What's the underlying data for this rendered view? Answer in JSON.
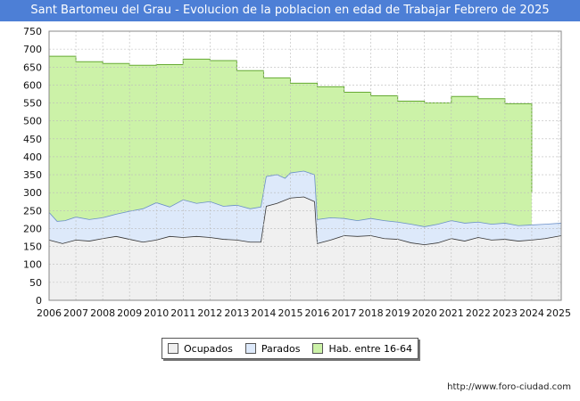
{
  "chart_data": {
    "type": "area",
    "title": "Sant Bartomeu del Grau - Evolucion de la poblacion en edad de Trabajar Febrero de 2025",
    "xlabel": "",
    "ylabel": "",
    "ylim": [
      0,
      750
    ],
    "xlim": [
      2006,
      2025.1
    ],
    "yticks": [
      0,
      50,
      100,
      150,
      200,
      250,
      300,
      350,
      400,
      450,
      500,
      550,
      600,
      650,
      700,
      750
    ],
    "xticks": [
      "2006",
      "2007",
      "2008",
      "2009",
      "2010",
      "2011",
      "2012",
      "2013",
      "2014",
      "2015",
      "2016",
      "2017",
      "2018",
      "2019",
      "2020",
      "2021",
      "2022",
      "2023",
      "2024",
      "2025"
    ],
    "grid": true,
    "legend_position": "bottom",
    "colors": {
      "hab": "#ccf2a8",
      "hab_line": "#66aa33",
      "parados": "#dde9fa",
      "parados_line": "#333333",
      "ocupados": "#f0f0f0",
      "ocupados_line": "#333333"
    },
    "series": [
      {
        "name": "Hab. entre 16-64",
        "type": "step",
        "points": [
          [
            2006,
            680
          ],
          [
            2007,
            665
          ],
          [
            2008,
            660
          ],
          [
            2009,
            655
          ],
          [
            2010,
            657
          ],
          [
            2011,
            672
          ],
          [
            2012,
            668
          ],
          [
            2013,
            640
          ],
          [
            2014,
            620
          ],
          [
            2015,
            605
          ],
          [
            2016,
            595
          ],
          [
            2017,
            580
          ],
          [
            2018,
            570
          ],
          [
            2019,
            555
          ],
          [
            2020,
            550
          ],
          [
            2021,
            568
          ],
          [
            2022,
            562
          ],
          [
            2023,
            548
          ],
          [
            2024,
            300
          ]
        ]
      },
      {
        "name": "Parados",
        "type": "line",
        "points": [
          [
            2006,
            245
          ],
          [
            2006.3,
            220
          ],
          [
            2006.6,
            222
          ],
          [
            2007,
            232
          ],
          [
            2007.5,
            225
          ],
          [
            2008,
            230
          ],
          [
            2008.5,
            240
          ],
          [
            2009,
            248
          ],
          [
            2009.5,
            255
          ],
          [
            2010,
            272
          ],
          [
            2010.5,
            260
          ],
          [
            2011,
            280
          ],
          [
            2011.5,
            270
          ],
          [
            2012,
            275
          ],
          [
            2012.5,
            262
          ],
          [
            2013,
            265
          ],
          [
            2013.5,
            255
          ],
          [
            2013.9,
            260
          ],
          [
            2014.1,
            345
          ],
          [
            2014.5,
            350
          ],
          [
            2014.8,
            340
          ],
          [
            2015,
            355
          ],
          [
            2015.5,
            360
          ],
          [
            2015.9,
            350
          ],
          [
            2016,
            225
          ],
          [
            2016.5,
            230
          ],
          [
            2017,
            228
          ],
          [
            2017.5,
            222
          ],
          [
            2018,
            228
          ],
          [
            2018.5,
            222
          ],
          [
            2019,
            218
          ],
          [
            2019.5,
            212
          ],
          [
            2020,
            205
          ],
          [
            2020.5,
            212
          ],
          [
            2021,
            222
          ],
          [
            2021.5,
            215
          ],
          [
            2022,
            218
          ],
          [
            2022.5,
            212
          ],
          [
            2023,
            215
          ],
          [
            2023.5,
            208
          ],
          [
            2024,
            210
          ],
          [
            2024.5,
            212
          ],
          [
            2025.1,
            215
          ]
        ]
      },
      {
        "name": "Ocupados",
        "type": "line",
        "points": [
          [
            2006,
            168
          ],
          [
            2006.5,
            158
          ],
          [
            2007,
            168
          ],
          [
            2007.5,
            165
          ],
          [
            2008,
            172
          ],
          [
            2008.5,
            178
          ],
          [
            2009,
            170
          ],
          [
            2009.5,
            162
          ],
          [
            2010,
            168
          ],
          [
            2010.5,
            178
          ],
          [
            2011,
            175
          ],
          [
            2011.5,
            178
          ],
          [
            2012,
            175
          ],
          [
            2012.5,
            170
          ],
          [
            2013,
            168
          ],
          [
            2013.5,
            162
          ],
          [
            2013.9,
            162
          ],
          [
            2014.1,
            262
          ],
          [
            2014.5,
            270
          ],
          [
            2015,
            285
          ],
          [
            2015.5,
            288
          ],
          [
            2015.9,
            275
          ],
          [
            2016,
            158
          ],
          [
            2016.5,
            168
          ],
          [
            2017,
            180
          ],
          [
            2017.5,
            178
          ],
          [
            2018,
            180
          ],
          [
            2018.5,
            172
          ],
          [
            2019,
            170
          ],
          [
            2019.5,
            160
          ],
          [
            2020,
            155
          ],
          [
            2020.5,
            160
          ],
          [
            2021,
            172
          ],
          [
            2021.5,
            165
          ],
          [
            2022,
            175
          ],
          [
            2022.5,
            168
          ],
          [
            2023,
            170
          ],
          [
            2023.5,
            165
          ],
          [
            2024,
            168
          ],
          [
            2024.5,
            172
          ],
          [
            2025.1,
            180
          ]
        ]
      }
    ]
  },
  "legend": [
    {
      "label": "Ocupados",
      "color": "#f0f0f0"
    },
    {
      "label": "Parados",
      "color": "#dde9fa"
    },
    {
      "label": "Hab. entre 16-64",
      "color": "#ccf2a8"
    }
  ],
  "footer": {
    "url": "http://www.foro-ciudad.com"
  }
}
